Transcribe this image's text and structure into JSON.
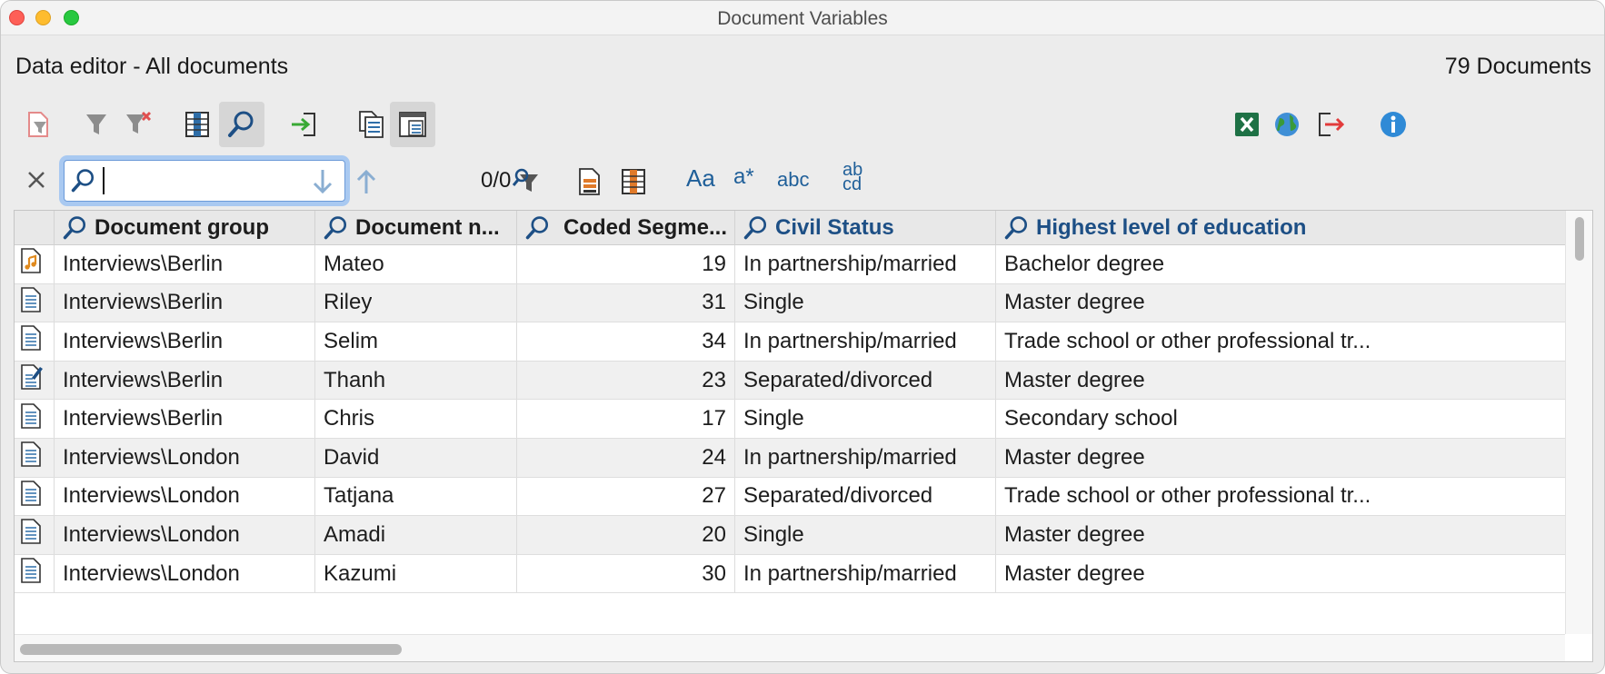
{
  "window": {
    "title": "Document Variables"
  },
  "header": {
    "editor_title": "Data editor - All documents",
    "document_count": "79 Documents"
  },
  "toolbar": {
    "left_buttons": [
      "filter-documents-icon",
      "filter-icon",
      "remove-filter-icon",
      "columns-icon",
      "search-icon",
      "import-icon",
      "list-variables-icon",
      "data-editor-icon"
    ],
    "right_buttons": [
      "excel-icon",
      "globe-icon",
      "export-icon",
      "info-icon"
    ]
  },
  "search": {
    "value": "",
    "placeholder": "",
    "counter": "0/0",
    "case_label": "Aa",
    "wildcard_label": "a*",
    "whole_word_label": "abc",
    "replace_label": "ab cd"
  },
  "table": {
    "columns": [
      {
        "label": "Document group",
        "searchable": true
      },
      {
        "label": "Document n...",
        "searchable": true
      },
      {
        "label": "Coded Segme...",
        "searchable": true
      },
      {
        "label": "Civil Status",
        "searchable": true
      },
      {
        "label": "Highest level of education",
        "searchable": true
      }
    ],
    "rows": [
      {
        "icon": "audio-document-icon",
        "group": "Interviews\\Berlin",
        "name": "Mateo",
        "coded": "19",
        "civil": "In partnership/married",
        "education": "Bachelor degree"
      },
      {
        "icon": "text-document-icon",
        "group": "Interviews\\Berlin",
        "name": "Riley",
        "coded": "31",
        "civil": "Single",
        "education": "Master degree"
      },
      {
        "icon": "text-document-icon",
        "group": "Interviews\\Berlin",
        "name": "Selim",
        "coded": "34",
        "civil": "In partnership/married",
        "education": "Trade school or other professional tr..."
      },
      {
        "icon": "edited-document-icon",
        "group": "Interviews\\Berlin",
        "name": "Thanh",
        "coded": "23",
        "civil": "Separated/divorced",
        "education": "Master degree"
      },
      {
        "icon": "text-document-icon",
        "group": "Interviews\\Berlin",
        "name": "Chris",
        "coded": "17",
        "civil": "Single",
        "education": "Secondary school"
      },
      {
        "icon": "text-document-icon",
        "group": "Interviews\\London",
        "name": "David",
        "coded": "24",
        "civil": "In partnership/married",
        "education": "Master degree"
      },
      {
        "icon": "text-document-icon",
        "group": "Interviews\\London",
        "name": "Tatjana",
        "coded": "27",
        "civil": "Separated/divorced",
        "education": "Trade school or other professional tr..."
      },
      {
        "icon": "text-document-icon",
        "group": "Interviews\\London",
        "name": "Amadi",
        "coded": "20",
        "civil": "Single",
        "education": "Master degree"
      },
      {
        "icon": "text-document-icon",
        "group": "Interviews\\London",
        "name": "Kazumi",
        "coded": "30",
        "civil": "In partnership/married",
        "education": "Master degree"
      }
    ]
  },
  "colors": {
    "accent": "#1d4f85",
    "search_focus": "#a9c9f1",
    "alt_row": "#f0f0f0"
  }
}
